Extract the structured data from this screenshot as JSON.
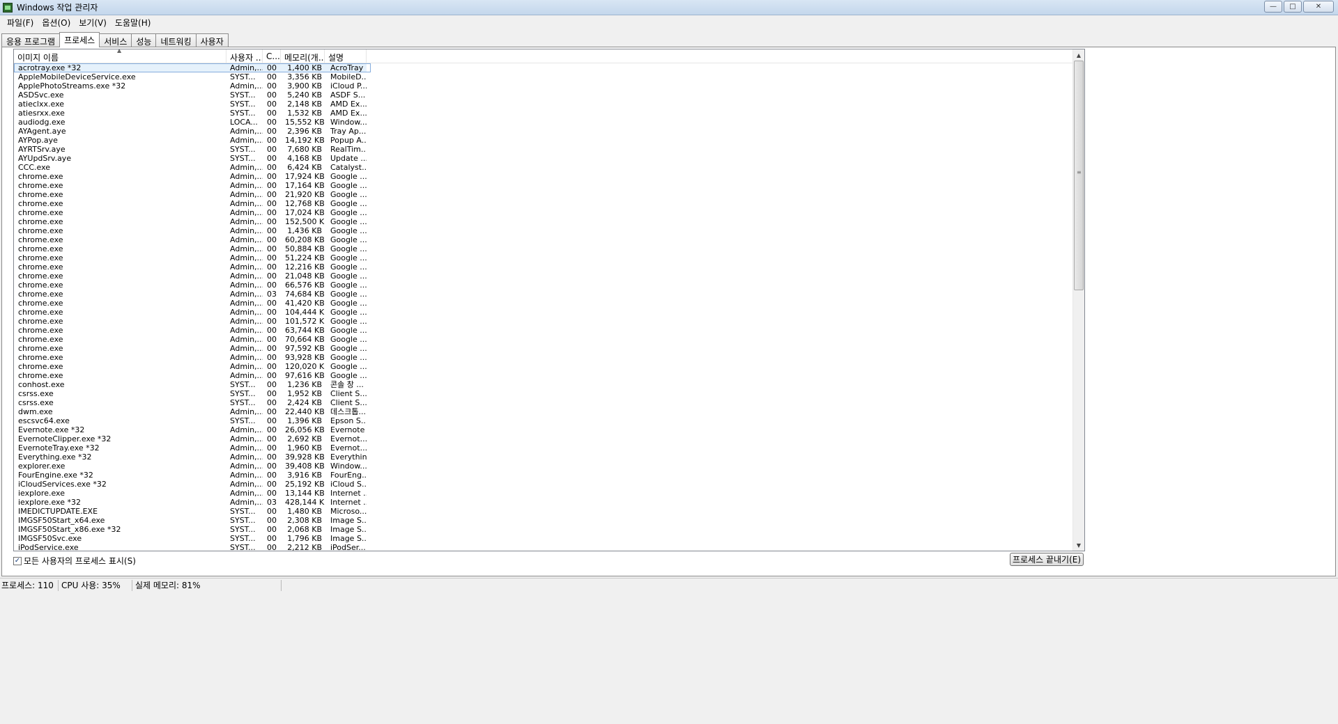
{
  "window": {
    "title": "Windows 작업 관리자",
    "controls": {
      "minimize": "—",
      "maximize": "□",
      "close": "✕"
    }
  },
  "menu": [
    "파일(F)",
    "옵션(O)",
    "보기(V)",
    "도움말(H)"
  ],
  "tabs": [
    "응용 프로그램",
    "프로세스",
    "서비스",
    "성능",
    "네트워킹",
    "사용자"
  ],
  "active_tab": "프로세스",
  "columns": {
    "name": "이미지 이름",
    "user": "사용자 ...",
    "cpu": "C...",
    "memory": "메모리(개...",
    "desc": "설명"
  },
  "processes": [
    {
      "name": "acrotray.exe *32",
      "user": "Admin,...",
      "cpu": "00",
      "mem": "1,400 KB",
      "desc": "AcroTray"
    },
    {
      "name": "AppleMobileDeviceService.exe",
      "user": "SYST...",
      "cpu": "00",
      "mem": "3,356 KB",
      "desc": "MobileD..."
    },
    {
      "name": "ApplePhotoStreams.exe *32",
      "user": "Admin,...",
      "cpu": "00",
      "mem": "3,900 KB",
      "desc": "iCloud P..."
    },
    {
      "name": "ASDSvc.exe",
      "user": "SYST...",
      "cpu": "00",
      "mem": "5,240 KB",
      "desc": "ASDF S..."
    },
    {
      "name": "atieclxx.exe",
      "user": "SYST...",
      "cpu": "00",
      "mem": "2,148 KB",
      "desc": "AMD Ex..."
    },
    {
      "name": "atiesrxx.exe",
      "user": "SYST...",
      "cpu": "00",
      "mem": "1,532 KB",
      "desc": "AMD Ex..."
    },
    {
      "name": "audiodg.exe",
      "user": "LOCA...",
      "cpu": "00",
      "mem": "15,552 KB",
      "desc": "Window..."
    },
    {
      "name": "AYAgent.aye",
      "user": "Admin,...",
      "cpu": "00",
      "mem": "2,396 KB",
      "desc": "Tray Ap..."
    },
    {
      "name": "AYPop.aye",
      "user": "Admin,...",
      "cpu": "00",
      "mem": "14,192 KB",
      "desc": "Popup A..."
    },
    {
      "name": "AYRTSrv.aye",
      "user": "SYST...",
      "cpu": "00",
      "mem": "7,680 KB",
      "desc": "RealTim..."
    },
    {
      "name": "AYUpdSrv.aye",
      "user": "SYST...",
      "cpu": "00",
      "mem": "4,168 KB",
      "desc": "Update ..."
    },
    {
      "name": "CCC.exe",
      "user": "Admin,...",
      "cpu": "00",
      "mem": "6,424 KB",
      "desc": "Catalyst..."
    },
    {
      "name": "chrome.exe",
      "user": "Admin,...",
      "cpu": "00",
      "mem": "17,924 KB",
      "desc": "Google ..."
    },
    {
      "name": "chrome.exe",
      "user": "Admin,...",
      "cpu": "00",
      "mem": "17,164 KB",
      "desc": "Google ..."
    },
    {
      "name": "chrome.exe",
      "user": "Admin,...",
      "cpu": "00",
      "mem": "21,920 KB",
      "desc": "Google ..."
    },
    {
      "name": "chrome.exe",
      "user": "Admin,...",
      "cpu": "00",
      "mem": "12,768 KB",
      "desc": "Google ..."
    },
    {
      "name": "chrome.exe",
      "user": "Admin,...",
      "cpu": "00",
      "mem": "17,024 KB",
      "desc": "Google ..."
    },
    {
      "name": "chrome.exe",
      "user": "Admin,...",
      "cpu": "00",
      "mem": "152,500 KB",
      "desc": "Google ..."
    },
    {
      "name": "chrome.exe",
      "user": "Admin,...",
      "cpu": "00",
      "mem": "1,436 KB",
      "desc": "Google ..."
    },
    {
      "name": "chrome.exe",
      "user": "Admin,...",
      "cpu": "00",
      "mem": "60,208 KB",
      "desc": "Google ..."
    },
    {
      "name": "chrome.exe",
      "user": "Admin,...",
      "cpu": "00",
      "mem": "50,884 KB",
      "desc": "Google ..."
    },
    {
      "name": "chrome.exe",
      "user": "Admin,...",
      "cpu": "00",
      "mem": "51,224 KB",
      "desc": "Google ..."
    },
    {
      "name": "chrome.exe",
      "user": "Admin,...",
      "cpu": "00",
      "mem": "12,216 KB",
      "desc": "Google ..."
    },
    {
      "name": "chrome.exe",
      "user": "Admin,...",
      "cpu": "00",
      "mem": "21,048 KB",
      "desc": "Google ..."
    },
    {
      "name": "chrome.exe",
      "user": "Admin,...",
      "cpu": "00",
      "mem": "66,576 KB",
      "desc": "Google ..."
    },
    {
      "name": "chrome.exe",
      "user": "Admin,...",
      "cpu": "03",
      "mem": "74,684 KB",
      "desc": "Google ..."
    },
    {
      "name": "chrome.exe",
      "user": "Admin,...",
      "cpu": "00",
      "mem": "41,420 KB",
      "desc": "Google ..."
    },
    {
      "name": "chrome.exe",
      "user": "Admin,...",
      "cpu": "00",
      "mem": "104,444 KB",
      "desc": "Google ..."
    },
    {
      "name": "chrome.exe",
      "user": "Admin,...",
      "cpu": "00",
      "mem": "101,572 KB",
      "desc": "Google ..."
    },
    {
      "name": "chrome.exe",
      "user": "Admin,...",
      "cpu": "00",
      "mem": "63,744 KB",
      "desc": "Google ..."
    },
    {
      "name": "chrome.exe",
      "user": "Admin,...",
      "cpu": "00",
      "mem": "70,664 KB",
      "desc": "Google ..."
    },
    {
      "name": "chrome.exe",
      "user": "Admin,...",
      "cpu": "00",
      "mem": "97,592 KB",
      "desc": "Google ..."
    },
    {
      "name": "chrome.exe",
      "user": "Admin,...",
      "cpu": "00",
      "mem": "93,928 KB",
      "desc": "Google ..."
    },
    {
      "name": "chrome.exe",
      "user": "Admin,...",
      "cpu": "00",
      "mem": "120,020 KB",
      "desc": "Google ..."
    },
    {
      "name": "chrome.exe",
      "user": "Admin,...",
      "cpu": "00",
      "mem": "97,616 KB",
      "desc": "Google ..."
    },
    {
      "name": "conhost.exe",
      "user": "SYST...",
      "cpu": "00",
      "mem": "1,236 KB",
      "desc": "콘솔 창 ..."
    },
    {
      "name": "csrss.exe",
      "user": "SYST...",
      "cpu": "00",
      "mem": "1,952 KB",
      "desc": "Client S..."
    },
    {
      "name": "csrss.exe",
      "user": "SYST...",
      "cpu": "00",
      "mem": "2,424 KB",
      "desc": "Client S..."
    },
    {
      "name": "dwm.exe",
      "user": "Admin,...",
      "cpu": "00",
      "mem": "22,440 KB",
      "desc": "데스크톱..."
    },
    {
      "name": "escsvc64.exe",
      "user": "SYST...",
      "cpu": "00",
      "mem": "1,396 KB",
      "desc": "Epson S..."
    },
    {
      "name": "Evernote.exe *32",
      "user": "Admin,...",
      "cpu": "00",
      "mem": "26,056 KB",
      "desc": "Evernote"
    },
    {
      "name": "EvernoteClipper.exe *32",
      "user": "Admin,...",
      "cpu": "00",
      "mem": "2,692 KB",
      "desc": "Evernot..."
    },
    {
      "name": "EvernoteTray.exe *32",
      "user": "Admin,...",
      "cpu": "00",
      "mem": "1,960 KB",
      "desc": "Evernot..."
    },
    {
      "name": "Everything.exe *32",
      "user": "Admin,...",
      "cpu": "00",
      "mem": "39,928 KB",
      "desc": "Everything"
    },
    {
      "name": "explorer.exe",
      "user": "Admin,...",
      "cpu": "00",
      "mem": "39,408 KB",
      "desc": "Window..."
    },
    {
      "name": "FourEngine.exe *32",
      "user": "Admin,...",
      "cpu": "00",
      "mem": "3,916 KB",
      "desc": "FourEng..."
    },
    {
      "name": "iCloudServices.exe *32",
      "user": "Admin,...",
      "cpu": "00",
      "mem": "25,192 KB",
      "desc": "iCloud S..."
    },
    {
      "name": "iexplore.exe",
      "user": "Admin,...",
      "cpu": "00",
      "mem": "13,144 KB",
      "desc": "Internet ..."
    },
    {
      "name": "iexplore.exe *32",
      "user": "Admin,...",
      "cpu": "03",
      "mem": "428,144 KB",
      "desc": "Internet ..."
    },
    {
      "name": "IMEDICTUPDATE.EXE",
      "user": "SYST...",
      "cpu": "00",
      "mem": "1,480 KB",
      "desc": "Microso..."
    },
    {
      "name": "IMGSF50Start_x64.exe",
      "user": "SYST...",
      "cpu": "00",
      "mem": "2,308 KB",
      "desc": "Image S..."
    },
    {
      "name": "IMGSF50Start_x86.exe *32",
      "user": "SYST...",
      "cpu": "00",
      "mem": "2,068 KB",
      "desc": "Image S..."
    },
    {
      "name": "IMGSF50Svc.exe",
      "user": "SYST...",
      "cpu": "00",
      "mem": "1,796 KB",
      "desc": "Image S..."
    },
    {
      "name": "iPodService.exe",
      "user": "SYST...",
      "cpu": "00",
      "mem": "2,212 KB",
      "desc": "iPodSer..."
    }
  ],
  "show_all_label": "모든 사용자의 프로세스 표시(S)",
  "show_all_checked": true,
  "end_process_label": "프로세스 끝내기(E)",
  "status": {
    "processes": "프로세스: 110",
    "cpu": "CPU 사용: 35%",
    "memory": "실제 메모리: 81%"
  },
  "colors": {
    "title_bar": "#c4d7ec",
    "selection": "#e5f1fb",
    "selection_border": "#84acdd"
  },
  "icons": {
    "app": "task-manager-icon",
    "sort": "sort-up-icon",
    "check": "checkmark-icon"
  }
}
